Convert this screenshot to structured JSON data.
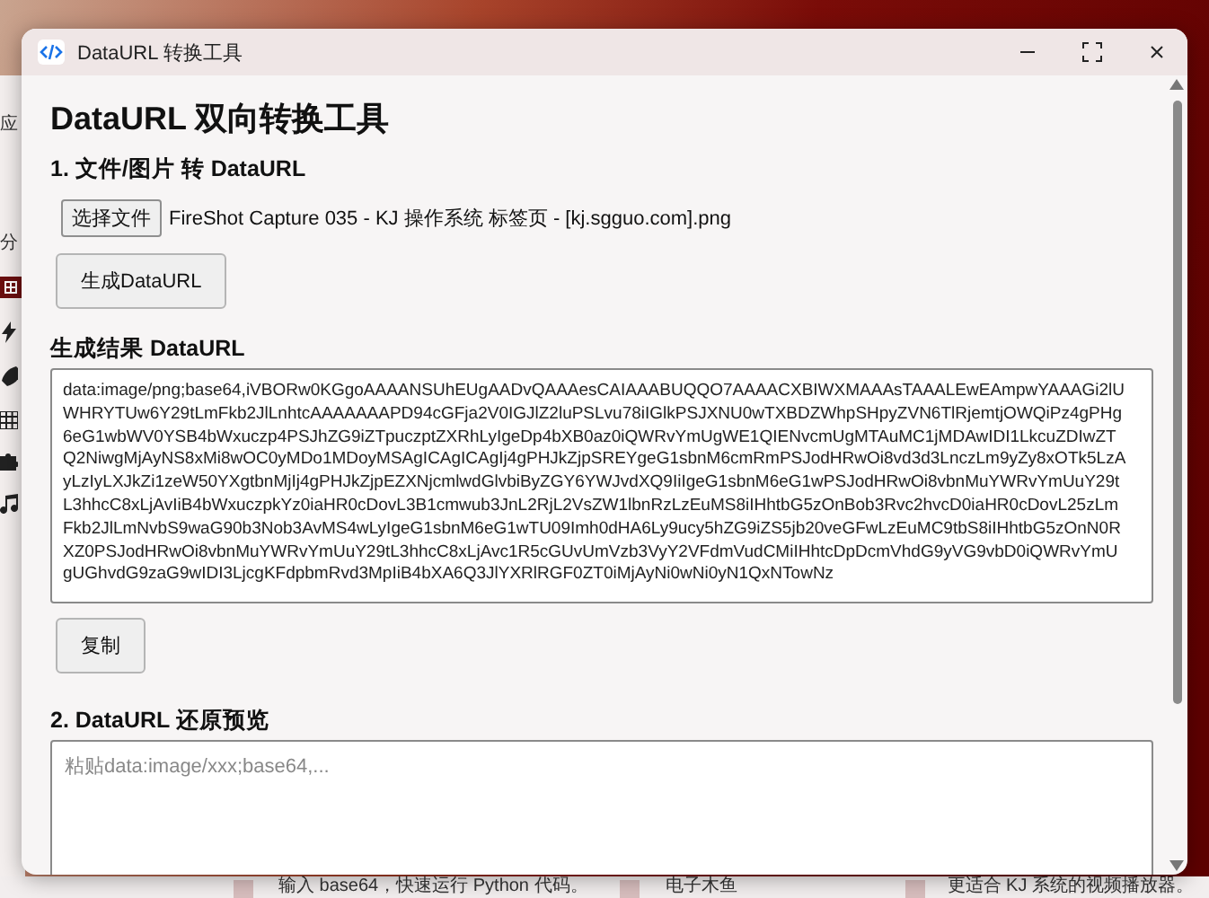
{
  "desktop": {
    "side_labels": [
      "应",
      "分"
    ],
    "bottom_texts": [
      "输入 base64，快速运行 Python 代码。",
      "电子木鱼",
      "更适合 KJ 系统的视频播放器。"
    ]
  },
  "window": {
    "title": "DataURL 转换工具",
    "heading": "DataURL 双向转换工具",
    "section1": {
      "title": "1. 文件/图片 转 DataURL",
      "file_button": "选择文件",
      "file_name": "FireShot Capture 035 - KJ 操作系统 标签页 - [kj.sgguo.com].png",
      "generate_button": "生成DataURL"
    },
    "result": {
      "title": "生成结果 DataURL",
      "value": "data:image/png;base64,iVBORw0KGgoAAAANSUhEUgAADvQAAAesCAIAAABUQQO7AAAACXBIWXMAAAsTAAALEwEAmpwYAAAGi2lUWHRYTUw6Y29tLmFkb2JlLnhtcAAAAAAAPD94cGFja2V0IGJlZ2luPSLvu78iIGlkPSJXNU0wTXBDZWhpSHpyZVN6TlRjemtjOWQiPz4gPHg6eG1wbWV0YSB4bWxuczp4PSJhZG9iZTpuczptZXRhLyIgeDp4bXB0az0iQWRvYmUgWE1QIENvcmUgMTAuMC1jMDAwIDI1LkcuZDIwZTQ2NiwgMjAyNS8xMi8wOC0yMDo1MDoyMSAgICAgICAgIj4gPHJkZjpSREYgeG1sbnM6cmRmPSJodHRwOi8vd3d3LnczLm9yZy8xOTk5LzAyLzIyLXJkZi1zeW50YXgtbnMjIj4gPHJkZjpEZXNjcmlwdGlvbiByZGY6YWJvdXQ9IiIgeG1sbnM6eG1wPSJodHRwOi8vbnMuYWRvYmUuY29tL3hhcC8xLjAvIiB4bWxuczpkYz0iaHR0cDovL3B1cmwub3JnL2RjL2VsZW1lbnRzLzEuMS8iIHhtbG5zOnBob3Rvc2hvcD0iaHR0cDovL25zLmFkb2JlLmNvbS9waG90b3Nob3AvMS4wLyIgeG1sbnM6eG1wTU09Imh0dHA6Ly9ucy5hZG9iZS5jb20veGFwLzEuMC9tbS8iIHhtbG5zOnN0RXZ0PSJodHRwOi8vbnMuYWRvYmUuY29tL3hhcC8xLjAvc1R5cGUvUmVzb3VyY2VFdmVudCMiIHhtcDpDcmVhdG9yVG9vbD0iQWRvYmUgUGhvdG9zaG9wIDI3LjcgKFdpbmRvd3MpIiB4bXA6Q3JlYXRlRGF0ZT0iMjAyNi0wNi0yN1QxNTowNz",
      "copy_button": "复制"
    },
    "section2": {
      "title": "2. DataURL 还原预览",
      "placeholder": "粘贴data:image/xxx;base64,..."
    }
  }
}
